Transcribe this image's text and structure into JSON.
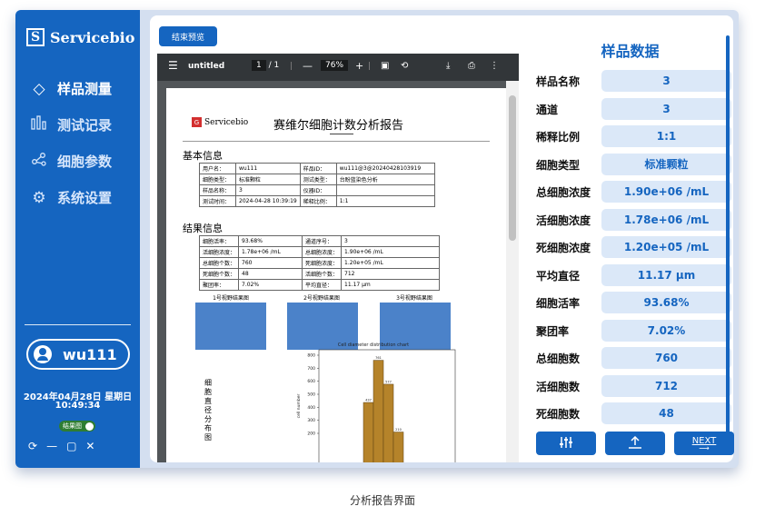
{
  "sidebar": {
    "brand_logo": "S",
    "brand": "Servicebio",
    "nav": [
      {
        "label": "样品测量",
        "icon": "diamond-icon"
      },
      {
        "label": "测试记录",
        "icon": "bar-chart-icon"
      },
      {
        "label": "细胞参数",
        "icon": "share-nodes-icon"
      },
      {
        "label": "系统设置",
        "icon": "gear-icon"
      }
    ],
    "user": "wu111",
    "date": "2024年04月28日 星期日",
    "time": "10:49:34",
    "toggle_label": "结果图"
  },
  "main": {
    "end_preview": "结束预览"
  },
  "viewer": {
    "filename": "untitled",
    "page_current": "1",
    "page_total": "/ 1",
    "zoom": "76%"
  },
  "report": {
    "brand_logo": "G",
    "brand": "Servicebio",
    "title": "赛维尔细胞计数分析报告",
    "section_basic": "基本信息",
    "basic": [
      [
        "用户名：",
        "wu111",
        "样品ID：",
        "wu111@3@20240428103919"
      ],
      [
        "细胞类型：",
        "标准颗粒",
        "测试类型：",
        "台盼蓝染色分析"
      ],
      [
        "样品名称：",
        "3",
        "仪器ID：",
        ""
      ],
      [
        "测试时间：",
        "2024-04-28 10:39:19",
        "稀释比例：",
        "1:1"
      ]
    ],
    "section_result": "结果信息",
    "result": [
      [
        "细胞活率：",
        "93.68%",
        "通道序号：",
        "3"
      ],
      [
        "活细胞浓度：",
        "1.78e+06 /mL",
        "总细胞浓度：",
        "1.90e+06 /mL"
      ],
      [
        "总细胞个数：",
        "760",
        "死细胞浓度：",
        "1.20e+05 /mL"
      ],
      [
        "死细胞个数：",
        "48",
        "活细胞个数：",
        "712"
      ],
      [
        "聚团率：",
        "7.02%",
        "平均直径：",
        "11.17 μm"
      ]
    ],
    "fields": [
      "1号视野结果图",
      "2号视野结果图",
      "3号视野结果图"
    ],
    "side_label": "细胞直径分布图"
  },
  "chart_data": {
    "type": "bar",
    "title": "Cell diameter distribution chart",
    "ylabel": "cell number",
    "ylim": [
      0,
      800
    ],
    "yticks": [
      "200",
      "300",
      "400",
      "500",
      "600",
      "700",
      "800"
    ],
    "categories": [
      "b1",
      "b2",
      "b3",
      "b4"
    ],
    "values": [
      437,
      761,
      577,
      210
    ],
    "value_labels": [
      "437",
      "761",
      "577",
      "210"
    ],
    "bar_color": "#b5832a"
  },
  "panel": {
    "title": "样品数据",
    "rows": [
      {
        "label": "样品名称",
        "value": "3"
      },
      {
        "label": "通道",
        "value": "3"
      },
      {
        "label": "稀释比例",
        "value": "1:1"
      },
      {
        "label": "细胞类型",
        "value": "标准颗粒"
      },
      {
        "label": "总细胞浓度",
        "value": "1.90e+06 /mL"
      },
      {
        "label": "活细胞浓度",
        "value": "1.78e+06 /mL"
      },
      {
        "label": "死细胞浓度",
        "value": "1.20e+05 /mL"
      },
      {
        "label": "平均直径",
        "value": "11.17 μm"
      },
      {
        "label": "细胞活率",
        "value": "93.68%"
      },
      {
        "label": "聚团率",
        "value": "7.02%"
      },
      {
        "label": "总细胞数",
        "value": "760"
      },
      {
        "label": "活细胞数",
        "value": "712"
      },
      {
        "label": "死细胞数",
        "value": "48"
      }
    ],
    "next": "NEXT"
  },
  "caption": "分析报告界面",
  "colors": {
    "primary": "#1565c0",
    "value_bg": "#dbe8f8",
    "toggle": "#2e7d32"
  }
}
